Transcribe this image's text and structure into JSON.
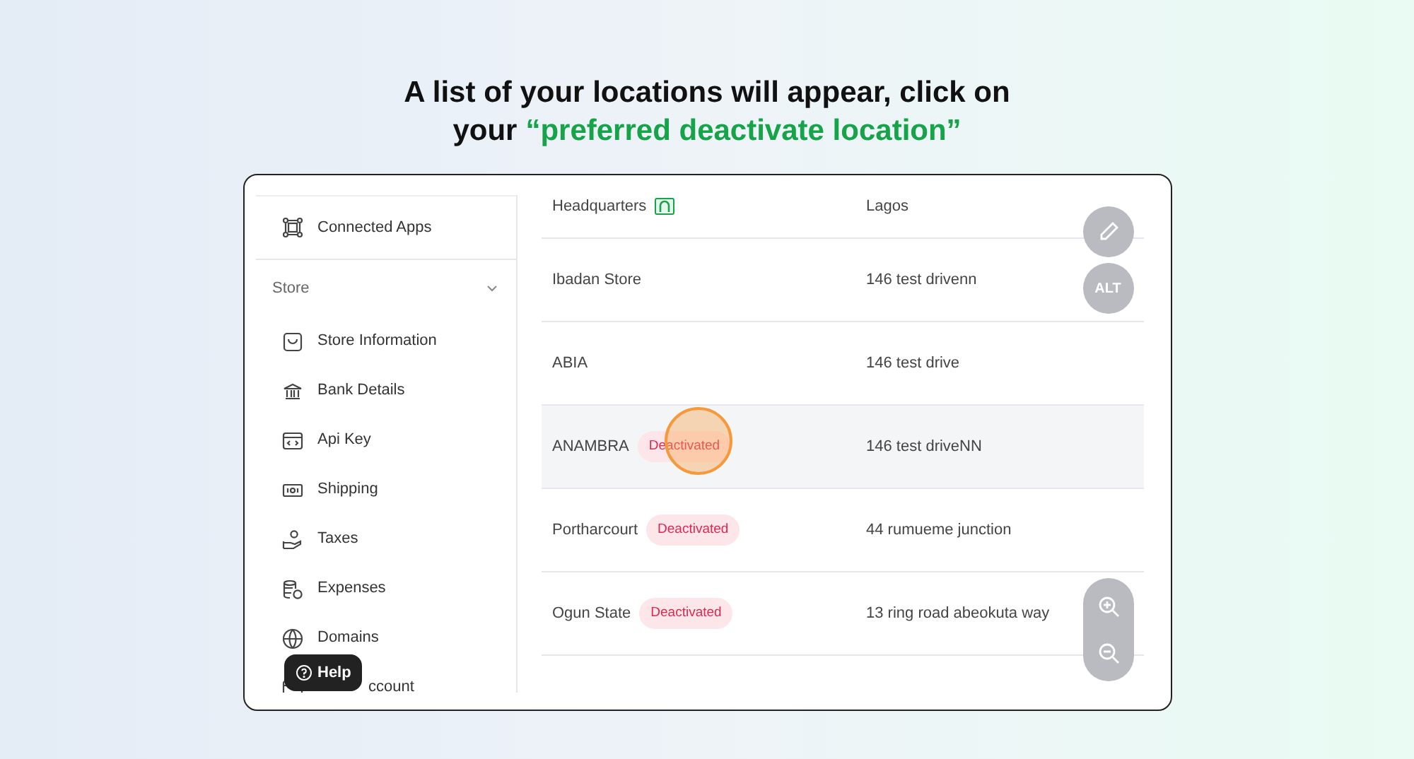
{
  "heading": {
    "line_1": "A list of your locations will appear, click on",
    "line_2": "your",
    "highlight": "“preferred deactivate location”"
  },
  "sidebar": {
    "top_item": {
      "label": "Connected Apps"
    },
    "section": {
      "label": "Store",
      "expanded": true
    },
    "items": [
      {
        "label": "Store Information"
      },
      {
        "label": "Bank Details"
      },
      {
        "label": "Api Key"
      },
      {
        "label": "Shipping"
      },
      {
        "label": "Taxes"
      },
      {
        "label": "Expenses"
      },
      {
        "label": "Domains"
      },
      {
        "label": "ccount"
      }
    ]
  },
  "help_button": {
    "label": "Help"
  },
  "locations": [
    {
      "name": "Headquarters",
      "headquarters": true,
      "address": "Lagos",
      "selected": false
    },
    {
      "name": "Ibadan Store",
      "headquarters": false,
      "address": "146 test drivenn",
      "selected": false
    },
    {
      "name": "ABIA",
      "headquarters": false,
      "address": "146 test drive",
      "selected": false
    },
    {
      "name": "ANAMBRA",
      "headquarters": false,
      "badge": "Deactivated",
      "address": "146 test driveNN",
      "selected": true
    },
    {
      "name": "Portharcourt",
      "headquarters": false,
      "badge": "Deactivated",
      "address": "44 rumueme junction",
      "selected": false
    },
    {
      "name": "Ogun State",
      "headquarters": false,
      "badge": "Deactivated",
      "address": "13 ring road abeokuta way",
      "selected": false
    }
  ],
  "alt_button": {
    "label": "ALT"
  }
}
